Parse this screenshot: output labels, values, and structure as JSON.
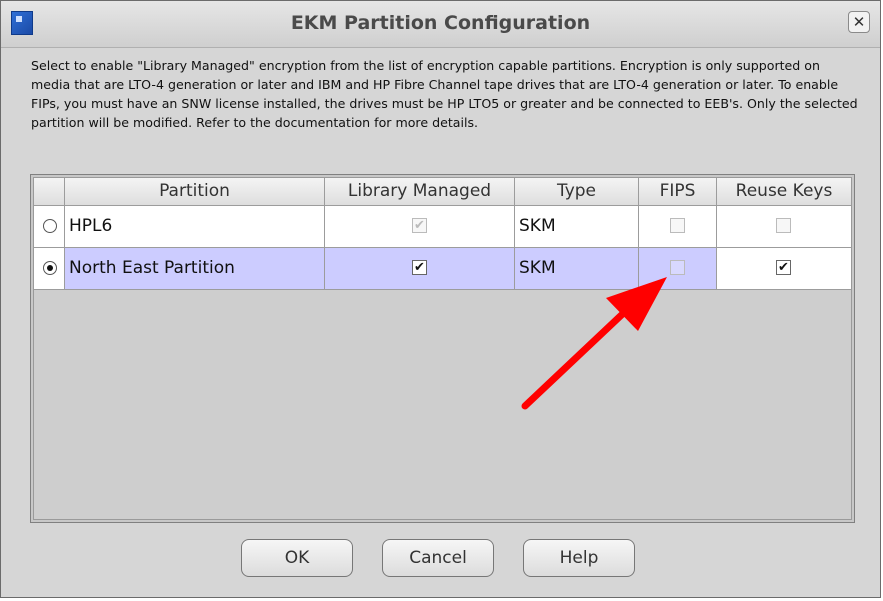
{
  "window": {
    "title": "EKM Partition Configuration",
    "close_glyph": "✕"
  },
  "description": "Select to enable \"Library Managed\" encryption from the list of encryption capable partitions. Encryption is only supported on media that are LTO-4 generation or later and IBM and HP Fibre Channel tape drives that are LTO-4 generation or later. To enable FIPs, you must have an SNW license installed, the drives must be HP LTO5 or greater and be connected to EEB's. Only the selected partition will be modified. Refer to the documentation for more details.",
  "table": {
    "headers": [
      "Partition",
      "Library Managed",
      "Type",
      "FIPS",
      "Reuse Keys"
    ],
    "rows": [
      {
        "partition": "HPL6",
        "selected": false,
        "library_managed": true,
        "library_managed_enabled": false,
        "type": "SKM",
        "fips": false,
        "reuse_keys": false
      },
      {
        "partition": "North East Partition",
        "selected": true,
        "library_managed": true,
        "library_managed_enabled": true,
        "type": "SKM",
        "fips": false,
        "reuse_keys": true
      }
    ]
  },
  "buttons": {
    "ok": "OK",
    "cancel": "Cancel",
    "help": "Help"
  },
  "annotation": {
    "arrow_color": "#ff0000"
  }
}
